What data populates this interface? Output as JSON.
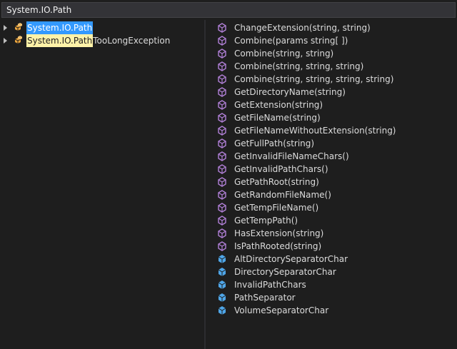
{
  "search": {
    "value": "System.IO.Path"
  },
  "tree": {
    "items": [
      {
        "highlight": "System.IO.Path",
        "rest": ""
      },
      {
        "highlight": "System.IO.Path",
        "rest": "TooLongException"
      }
    ]
  },
  "members": {
    "methods": [
      "ChangeExtension(string, string)",
      "Combine(params string[ ])",
      "Combine(string, string)",
      "Combine(string, string, string)",
      "Combine(string, string, string, string)",
      "GetDirectoryName(string)",
      "GetExtension(string)",
      "GetFileName(string)",
      "GetFileNameWithoutExtension(string)",
      "GetFullPath(string)",
      "GetInvalidFileNameChars()",
      "GetInvalidPathChars()",
      "GetPathRoot(string)",
      "GetRandomFileName()",
      "GetTempFileName()",
      "GetTempPath()",
      "HasExtension(string)",
      "IsPathRooted(string)"
    ],
    "fields": [
      "AltDirectorySeparatorChar",
      "DirectorySeparatorChar",
      "InvalidPathChars",
      "PathSeparator",
      "VolumeSeparatorChar"
    ]
  },
  "colors": {
    "background": "#1e1e1e",
    "selection": "#3399ff",
    "highlight": "#fff2a8",
    "method_icon": "#b180d7",
    "field_icon": "#4fa6e8",
    "class_icon": "#e8a33d"
  }
}
